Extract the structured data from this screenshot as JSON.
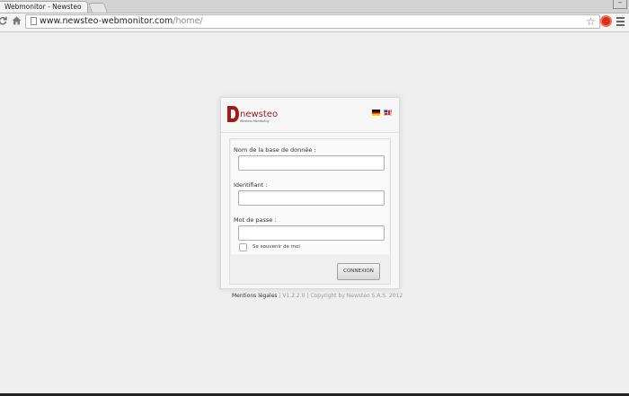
{
  "browser": {
    "tab_title": "Webmonitor - Newsteo",
    "url_host": "www.newsteo-webmonitor.com",
    "url_path": "/home/",
    "minimize_glyph": "–",
    "back_icon": "refresh-icon",
    "home_icon": "home-icon",
    "star_icon": "star-icon",
    "extension_icon": "opera-extension-icon",
    "extension_color": "#d4301d"
  },
  "login": {
    "logo_text": "newsteo",
    "logo_tagline": "Wireless Monitoring",
    "brand_color": "#a11919",
    "languages": [
      "de",
      "en"
    ],
    "database_label": "Nom de la base de donnée :",
    "database_value": "",
    "identifier_label": "Identifiant :",
    "identifier_value": "",
    "password_label": "Mot de passe :",
    "password_value": "",
    "remember_label": "Se souvenir de moi",
    "remember_checked": false,
    "submit_label": "CONNEXION"
  },
  "footer": {
    "legal_link": "Mentions légales",
    "version": "| V1.2.2.0 | Copyright by Newsteo S.A.S. 2012"
  }
}
